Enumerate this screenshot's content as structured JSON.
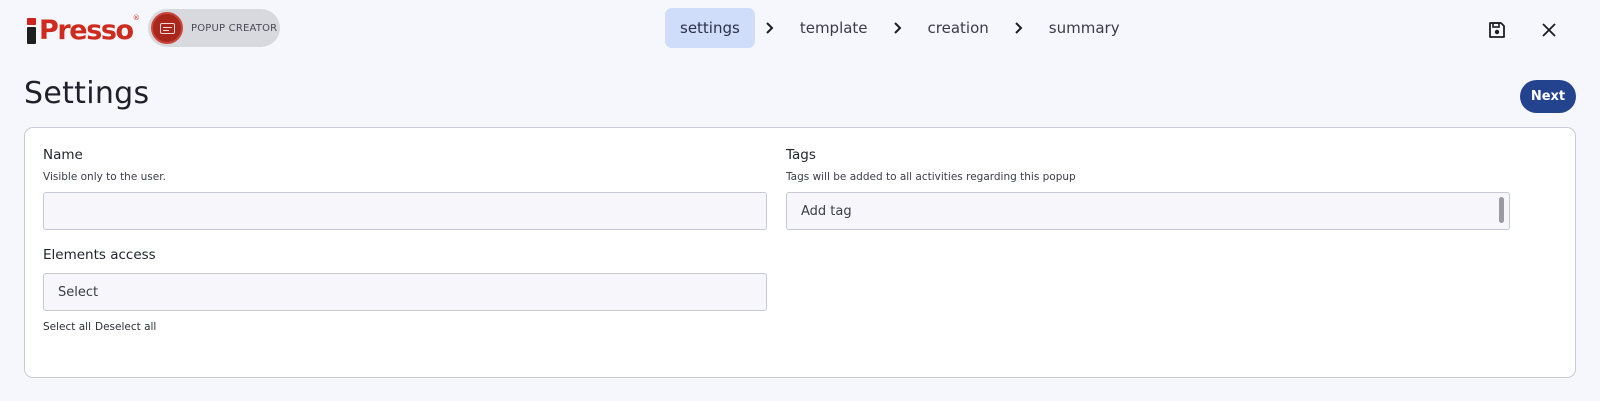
{
  "app": {
    "logo_text": "Presso",
    "logo_mark": "®",
    "module_label": "POPUP CREATOR",
    "module_icon": "popup-window-icon"
  },
  "steps": [
    {
      "label": "settings",
      "active": true
    },
    {
      "label": "template",
      "active": false
    },
    {
      "label": "creation",
      "active": false
    },
    {
      "label": "summary",
      "active": false
    }
  ],
  "toolbar": {
    "save_icon": "floppy-disk-icon",
    "close_icon": "close-icon"
  },
  "page": {
    "title": "Settings",
    "next_label": "Next"
  },
  "form": {
    "name": {
      "label": "Name",
      "help": "Visible only to the user.",
      "value": "",
      "placeholder": ""
    },
    "tags": {
      "label": "Tags",
      "help": "Tags will be added to all activities regarding this popup",
      "placeholder": "Add tag"
    },
    "elements_access": {
      "label": "Elements access",
      "selected": "Select",
      "select_all": "Select all",
      "deselect_all": "Deselect all"
    }
  },
  "colors": {
    "brand_red": "#cf2a1e",
    "primary_button": "#24438f",
    "active_step_bg": "#cfdcfa",
    "page_bg": "#f6f6fd"
  }
}
